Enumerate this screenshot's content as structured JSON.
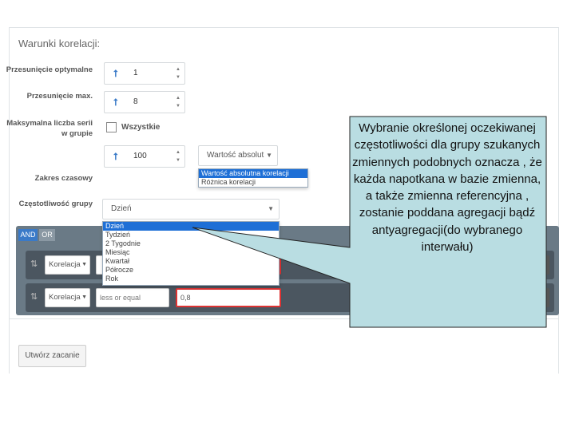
{
  "panel": {
    "title": "Warunki korelacji:"
  },
  "fields": {
    "offset_optimal": {
      "label": "Przesunięcie optymalne",
      "value": "1"
    },
    "offset_max": {
      "label": "Przesunięcie max.",
      "value": "8"
    },
    "max_series": {
      "label": "Maksymalna liczba serii w grupie",
      "checkbox_label": "Wszystkie",
      "value": "100"
    },
    "correlation_mode": {
      "selected": "Wartość absolut",
      "options": [
        "Wartość absolutna korelacji",
        "Różnica korelacji"
      ]
    },
    "time_range": {
      "label": "Zakres czasowy"
    },
    "group_frequency": {
      "label": "Częstotliwość grupy",
      "selected": "Dzień",
      "options": [
        "Dzień",
        "Tydzień",
        "2 Tygodnie",
        "Miesiąc",
        "Kwartał",
        "Półrocze",
        "Rok"
      ]
    }
  },
  "rules": {
    "and_label": "AND",
    "or_label": "OR",
    "rows": [
      {
        "field": "Korelacja",
        "operator": "",
        "value": ""
      },
      {
        "field": "Korelacja",
        "operator": "less or equal",
        "value": "0,8"
      }
    ]
  },
  "actions": {
    "create_label": "Utwórz zacanie"
  },
  "callout": {
    "text": "Wybranie określonej oczekiwanej częstotliwości dla grupy szukanych zmiennych podobnych oznacza , że każda napotkana w bazie zmienna, a także zmienna referencyjna , zostanie poddana agregacji bądź antyagregacji(do wybranego interwału)",
    "fill": "#b9dde2",
    "border": "#222222"
  }
}
